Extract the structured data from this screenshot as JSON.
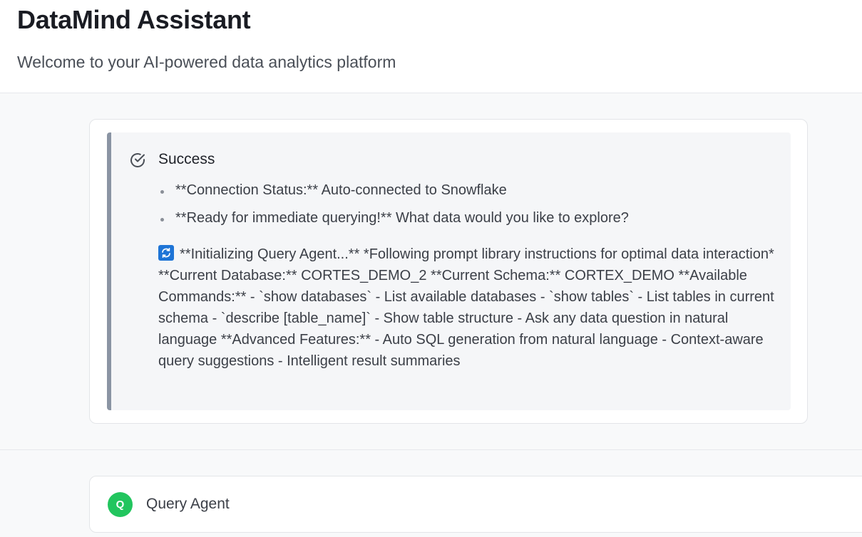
{
  "app": {
    "title": "DataMind Assistant",
    "subtitle": "Welcome to your AI-powered data analytics platform"
  },
  "status_alert": {
    "icon": "check-circle-icon",
    "title": "Success",
    "bullets": [
      "**Connection Status:** Auto-connected to Snowflake",
      "**Ready for immediate querying!** What data would you like to explore?"
    ],
    "body_icon": "sync-icon",
    "body_text": "**Initializing Query Agent...** *Following prompt library instructions for optimal data interaction* **Current Database:** CORTES_DEMO_2 **Current Schema:** CORTEX_DEMO **Available Commands:** - `show databases` - List available databases - `show tables` - List tables in current schema - `describe [table_name]` - Show table structure - Ask any data question in natural language **Advanced Features:** - Auto SQL generation from natural language - Context-aware query suggestions - Intelligent result summaries"
  },
  "agent_message": {
    "avatar_letter": "Q",
    "avatar_color": "#22c55e",
    "name": "Query Agent"
  },
  "colors": {
    "alert_border": "#8a94a3",
    "sync_icon_bg": "#1e74d6"
  }
}
